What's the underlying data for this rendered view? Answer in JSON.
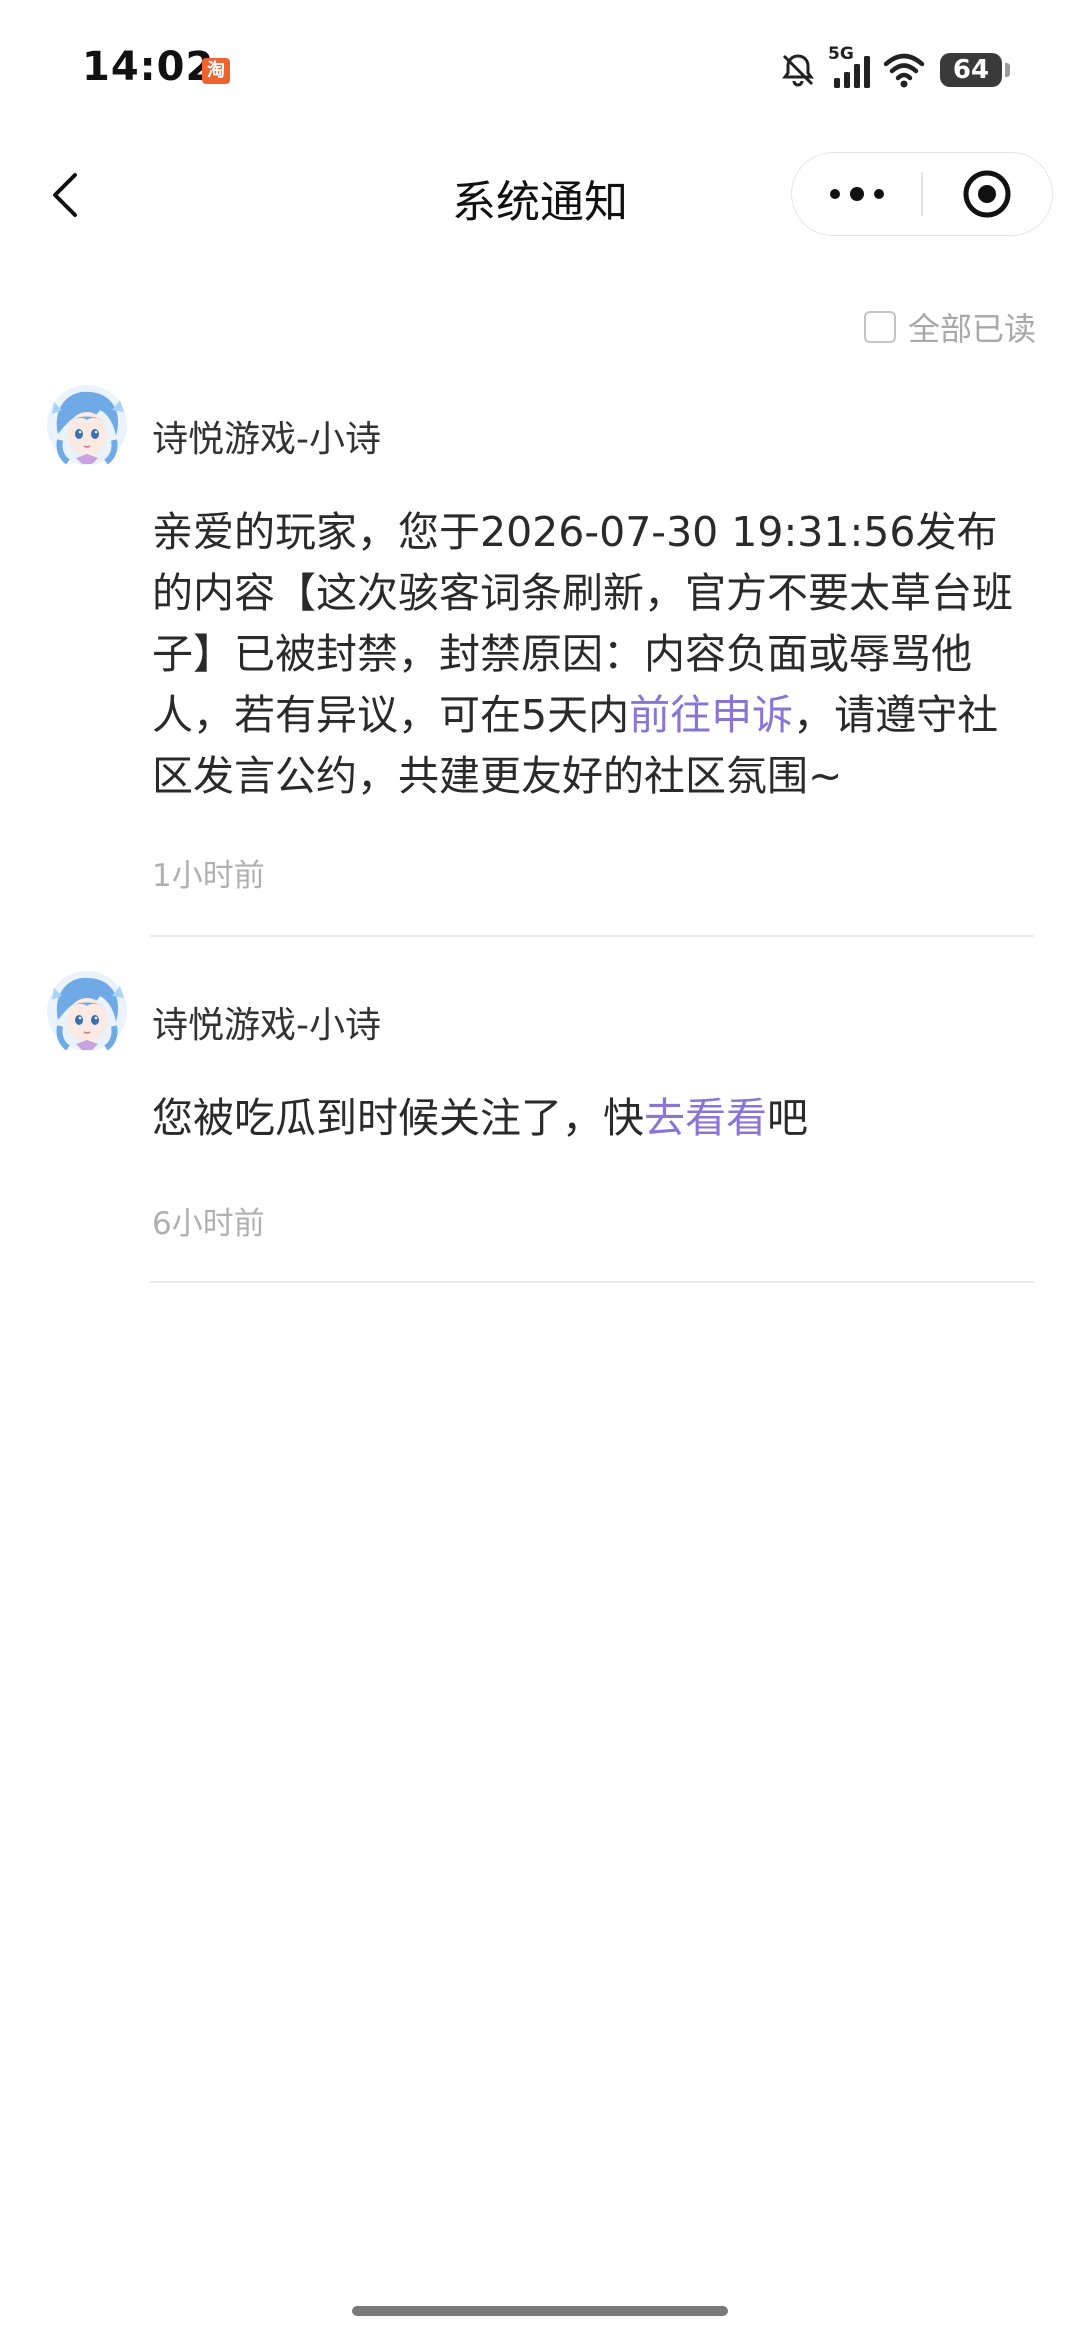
{
  "status_bar": {
    "time": "14:02",
    "app_badge": "淘",
    "network": "5G",
    "battery": "64"
  },
  "nav": {
    "title": "系统通知"
  },
  "mark_all_read": {
    "label": "全部已读",
    "checked": false
  },
  "notifications": [
    {
      "sender": "诗悦游戏-小诗",
      "body_before_link": "亲爱的玩家，您于2026-07-30 19:31:56发布的内容【这次骇客词条刷新，官方不要太草台班子】已被封禁，封禁原因：内容负面或辱骂他人，若有异议，可在5天内",
      "link_text": "前往申诉",
      "body_after_link": "，请遵守社区发言公约，共建更友好的社区氛围~",
      "time_ago": "1小时前"
    },
    {
      "sender": "诗悦游戏-小诗",
      "body_before_link": "您被吃瓜到时候关注了，快",
      "link_text": "去看看",
      "body_after_link": "吧",
      "time_ago": "6小时前"
    }
  ],
  "colors": {
    "link": "#8a74d6",
    "avatar_hair": "#6fa9e6",
    "muted_text": "#b0b0b0"
  },
  "icons": {
    "back": "chevron-left-icon",
    "more": "more-dots-icon",
    "close": "target-circle-icon",
    "mute": "bell-off-icon",
    "signal": "signal-icon",
    "wifi": "wifi-icon"
  }
}
